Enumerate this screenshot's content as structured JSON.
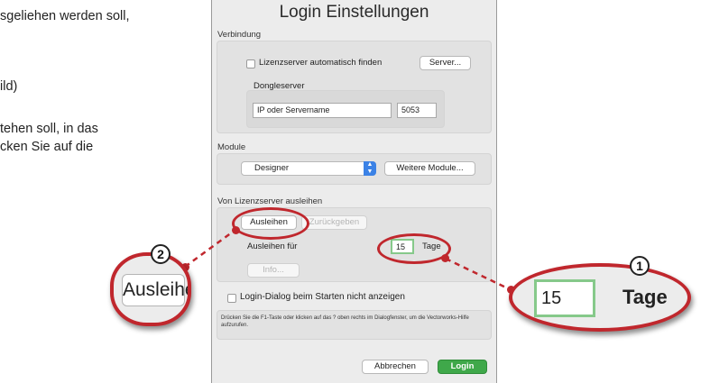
{
  "doc_text": {
    "line1": "sgeliehen werden soll,",
    "line2": "ild)",
    "line3": "tehen soll, in das",
    "line4": "cken Sie auf die"
  },
  "dialog": {
    "title": "Login Einstellungen",
    "connection": {
      "section_label": "Verbindung",
      "auto_find_label": "Lizenzserver automatisch finden",
      "auto_find_checked": false,
      "server_button": "Server...",
      "dongle_label": "Dongleserver",
      "ip_placeholder": "IP oder Servername",
      "port_value": "5053"
    },
    "modules": {
      "section_label": "Module",
      "selected_module": "Designer",
      "more_button": "Weitere Module..."
    },
    "borrow": {
      "section_label": "Von Lizenzserver ausleihen",
      "borrow_button": "Ausleihen",
      "return_button": "Zurückgeben",
      "borrow_for_label": "Ausleihen für",
      "days_value": "15",
      "days_unit": "Tage",
      "info_button": "Info..."
    },
    "no_login_dialog_label": "Login-Dialog beim Starten nicht anzeigen",
    "no_login_dialog_checked": false,
    "help_text": "Drücken Sie die F1-Taste oder klicken auf das ? oben rechts im Dialogfenster, um die Vectorworks-Hilfe aufzurufen.",
    "cancel_button": "Abbrechen",
    "login_button": "Login"
  },
  "callouts": {
    "marker1": "1",
    "marker2": "2",
    "zoom_borrow_button": "Ausleihen",
    "zoom_days_value": "15",
    "zoom_days_unit": "Tage"
  },
  "colors": {
    "callout_red": "#c0272d",
    "login_green": "#3fa84a",
    "select_blue": "#3b82e6"
  }
}
